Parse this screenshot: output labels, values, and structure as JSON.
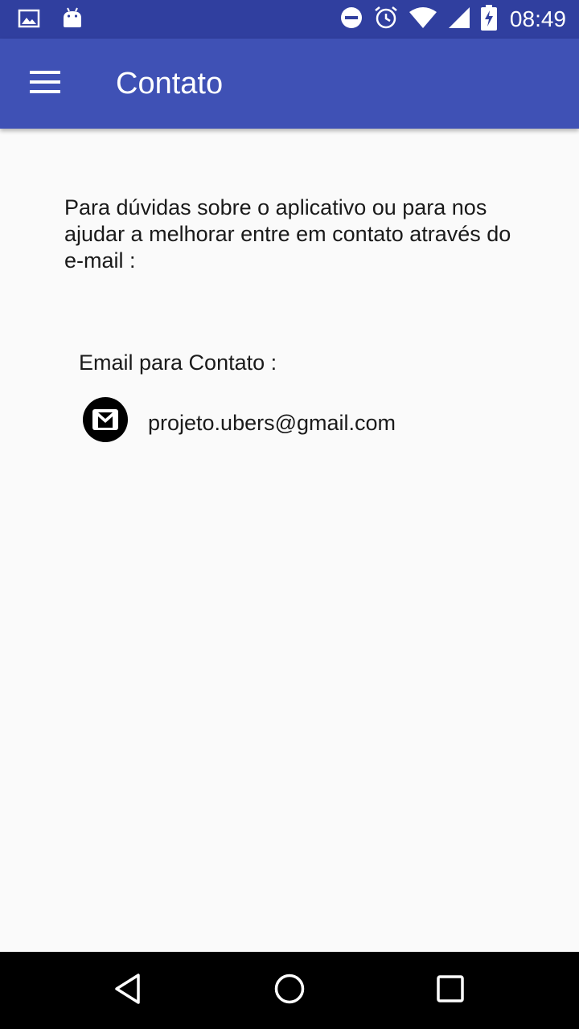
{
  "status_bar": {
    "time": "08:49",
    "left_icons": [
      "image-icon",
      "android-icon"
    ],
    "right_icons": [
      "do-not-disturb-icon",
      "alarm-icon",
      "wifi-icon",
      "cell-signal-icon",
      "battery-charging-icon"
    ]
  },
  "app_bar": {
    "title": "Contato",
    "menu_icon": "hamburger-menu-icon"
  },
  "main": {
    "intro_text": "Para dúvidas sobre o aplicativo ou para nos ajudar a melhorar entre em contato através do e-mail :",
    "contact_label": "Email para Contato :",
    "email": "projeto.ubers@gmail.com",
    "email_icon": "gmail-icon"
  },
  "nav_bar": {
    "buttons": [
      "back-icon",
      "home-icon",
      "recents-icon"
    ]
  },
  "colors": {
    "status_bar": "#303f9f",
    "app_bar": "#3f51b5",
    "background": "#fafafa",
    "nav_bar": "#000000",
    "text": "#1a1a1a"
  }
}
